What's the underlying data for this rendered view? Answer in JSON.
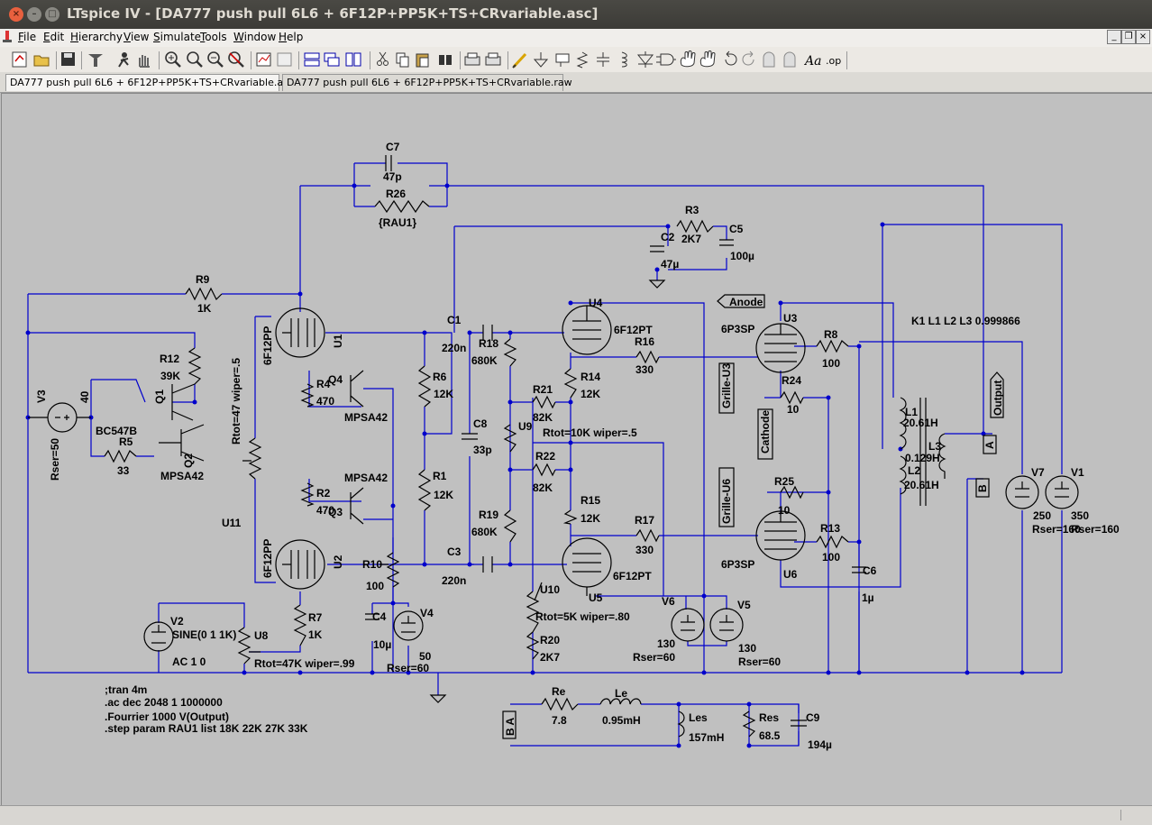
{
  "window": {
    "title": "LTspice IV - [DA777 push pull 6L6 + 6F12P+PP5K+TS+CRvariable.asc]"
  },
  "menu": [
    "File",
    "Edit",
    "Hierarchy",
    "View",
    "Simulate",
    "Tools",
    "Window",
    "Help"
  ],
  "tabs": [
    "DA777 push pull 6L6 + 6F12P+PP5K+TS+CRvariable.asc",
    "DA777 push pull 6L6 + 6F12P+PP5K+TS+CRvariable.raw"
  ],
  "toolbar_icons": [
    "new-schematic-icon",
    "open-icon",
    "save-icon",
    "control-panel-icon",
    "run-icon",
    "halt-icon",
    "zoom-in-icon",
    "pan-icon",
    "zoom-out-icon",
    "zoom-cancel-icon",
    "autoscale-icon",
    "view-fit-icon",
    "tile-horizontal-icon",
    "cascade-icon",
    "tile-vertical-icon",
    "cut-icon",
    "copy-icon",
    "paste-icon",
    "find-icon",
    "print-setup-icon",
    "print-icon",
    "wire-icon",
    "ground-icon",
    "label-icon",
    "resistor-icon",
    "capacitor-icon",
    "inductor-icon",
    "diode-icon",
    "component-icon",
    "move-icon",
    "drag-icon",
    "undo-icon",
    "redo-icon",
    "rotate-icon",
    "mirror-icon",
    "text-icon",
    "spice-directive-icon"
  ],
  "schematic": {
    "components": {
      "C7": {
        "name": "C7",
        "value": "47p"
      },
      "R26": {
        "name": "R26",
        "value": "{RAU1}"
      },
      "R3": {
        "name": "R3",
        "value": "2K7"
      },
      "C2": {
        "name": "C2",
        "value": "47µ"
      },
      "C5": {
        "name": "C5",
        "value": "100µ"
      },
      "R9": {
        "name": "R9",
        "value": "1K"
      },
      "R12": {
        "name": "R12",
        "value": "39K"
      },
      "Q1": {
        "name": "Q1",
        "value": "BC547B"
      },
      "R5": {
        "name": "R5",
        "value": "33"
      },
      "Q2": {
        "name": "Q2",
        "value": "MPSA42"
      },
      "V3": {
        "name": "V3",
        "value": "40",
        "rser": "Rser=50"
      },
      "U1": {
        "name": "U1",
        "value": "6F12PP"
      },
      "R4": {
        "name": "R4",
        "value": "470"
      },
      "Q4": {
        "name": "Q4",
        "value": "MPSA42"
      },
      "U11": {
        "name": "U11",
        "value": "Rtot=47 wiper=.5"
      },
      "R2": {
        "name": "R2",
        "value": "470"
      },
      "Q3": {
        "name": "Q3",
        "value": "MPSA42"
      },
      "U2": {
        "name": "U2",
        "value": "6F12PP"
      },
      "R10": {
        "name": "R10",
        "value": "100"
      },
      "R7": {
        "name": "R7",
        "value": "1K"
      },
      "V2": {
        "name": "V2",
        "value": "SINE(0 1 1K)",
        "ac": "AC 1 0"
      },
      "U8": {
        "name": "U8",
        "value": "Rtot=47K wiper=.99"
      },
      "C4": {
        "name": "C4",
        "value": "10µ"
      },
      "V4": {
        "name": "V4",
        "value": "50",
        "rser": "Rser=60"
      },
      "R6": {
        "name": "R6",
        "value": "12K"
      },
      "R1": {
        "name": "R1",
        "value": "12K"
      },
      "C1": {
        "name": "C1",
        "value": "220n"
      },
      "C8": {
        "name": "C8",
        "value": "33p"
      },
      "C3": {
        "name": "C3",
        "value": "220n"
      },
      "R18": {
        "name": "R18",
        "value": "680K"
      },
      "R19": {
        "name": "R19",
        "value": "680K"
      },
      "U9": {
        "name": "U9",
        "value": "Rtot=10K wiper=.5"
      },
      "R21": {
        "name": "R21",
        "value": "82K"
      },
      "R22": {
        "name": "R22",
        "value": "82K"
      },
      "U10": {
        "name": "U10",
        "value": "Rtot=5K wiper=.80"
      },
      "R20": {
        "name": "R20",
        "value": "2K7"
      },
      "U4": {
        "name": "U4",
        "value": "6F12PT"
      },
      "U5": {
        "name": "U5",
        "value": "6F12PT"
      },
      "R14": {
        "name": "R14",
        "value": "12K"
      },
      "R15": {
        "name": "R15",
        "value": "12K"
      },
      "R16": {
        "name": "R16",
        "value": "330"
      },
      "R17": {
        "name": "R17",
        "value": "330"
      },
      "V6": {
        "name": "V6",
        "value": "130",
        "rser": "Rser=60"
      },
      "V5": {
        "name": "V5",
        "value": "130",
        "rser": "Rser=60"
      },
      "U3": {
        "name": "U3",
        "value": "6P3SP"
      },
      "U6": {
        "name": "U6",
        "value": "6P3SP"
      },
      "R8": {
        "name": "R8",
        "value": "100"
      },
      "R24": {
        "name": "R24",
        "value": "10"
      },
      "R25": {
        "name": "R25",
        "value": "10"
      },
      "R13": {
        "name": "R13",
        "value": "100"
      },
      "C6": {
        "name": "C6",
        "value": "1µ"
      },
      "L1": {
        "name": "L1",
        "value": "20.61H"
      },
      "L2": {
        "name": "L2",
        "value": "20.61H"
      },
      "L3": {
        "name": "L3",
        "value": "0.129H"
      },
      "V7": {
        "name": "V7",
        "value": "250",
        "rser": "Rser=160"
      },
      "V1": {
        "name": "V1",
        "value": "350",
        "rser": "Rser=160"
      },
      "Re": {
        "name": "Re",
        "value": "7.8"
      },
      "Le": {
        "name": "Le",
        "value": "0.95mH"
      },
      "Les": {
        "name": "Les",
        "value": "157mH"
      },
      "Res": {
        "name": "Res",
        "value": "68.5"
      },
      "C9": {
        "name": "C9",
        "value": "194µ"
      }
    },
    "net_labels": {
      "anode": "Anode",
      "grille_u3": "Grille-U3",
      "grille_u6": "Grille-U6",
      "cathode": "Cathode",
      "output": "Output",
      "a": "A",
      "b": "B",
      "ba": "B A"
    },
    "coupling": "K1 L1 L2 L3 0.999866",
    "directives": [
      ";tran 4m",
      ".ac dec 2048 1 1000000",
      ".Fourrier 1000 V(Output)",
      ".step param RAU1 list 18K 22K 27K 33K"
    ]
  }
}
